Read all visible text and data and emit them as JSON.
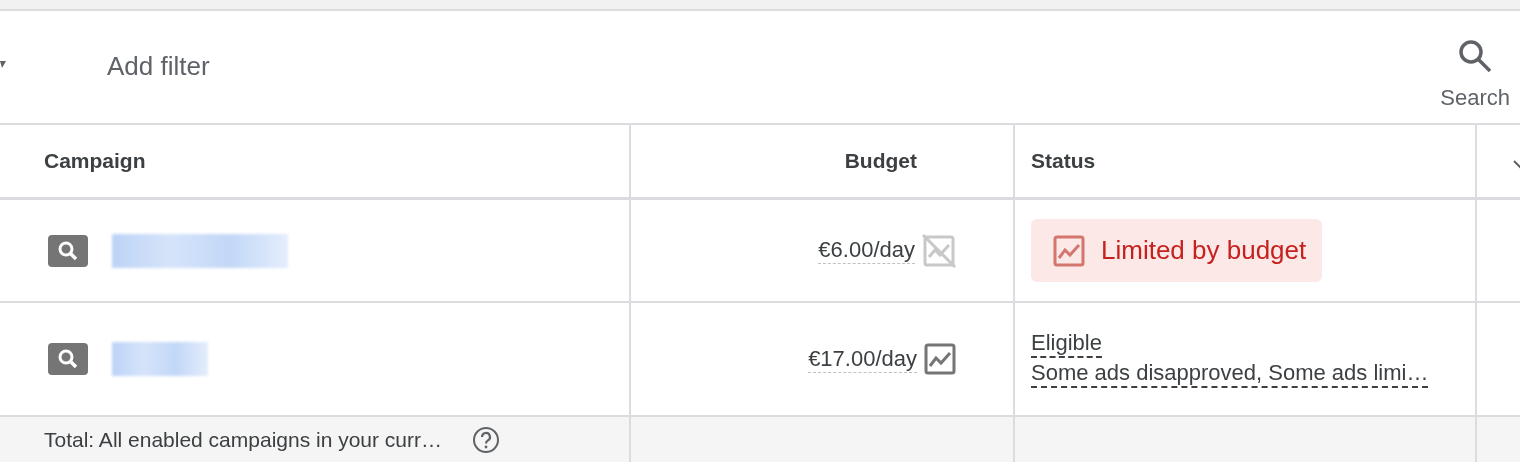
{
  "toolbar": {
    "filter_label": "Add filter",
    "search_label": "Search"
  },
  "table": {
    "columns": [
      {
        "label": "Campaign"
      },
      {
        "label": "Budget"
      },
      {
        "label": "Status"
      }
    ],
    "rows": [
      {
        "budget": "€6.00/day",
        "budget_chart_disabled": true,
        "status": {
          "kind": "badge",
          "label": "Limited by budget"
        }
      },
      {
        "budget": "€17.00/day",
        "budget_chart_disabled": false,
        "status": {
          "kind": "text",
          "label": "Eligible",
          "detail": "Some ads disapproved, Some ads limi…"
        }
      }
    ],
    "total": {
      "label": "Total: All enabled campaigns in your curr…"
    }
  }
}
